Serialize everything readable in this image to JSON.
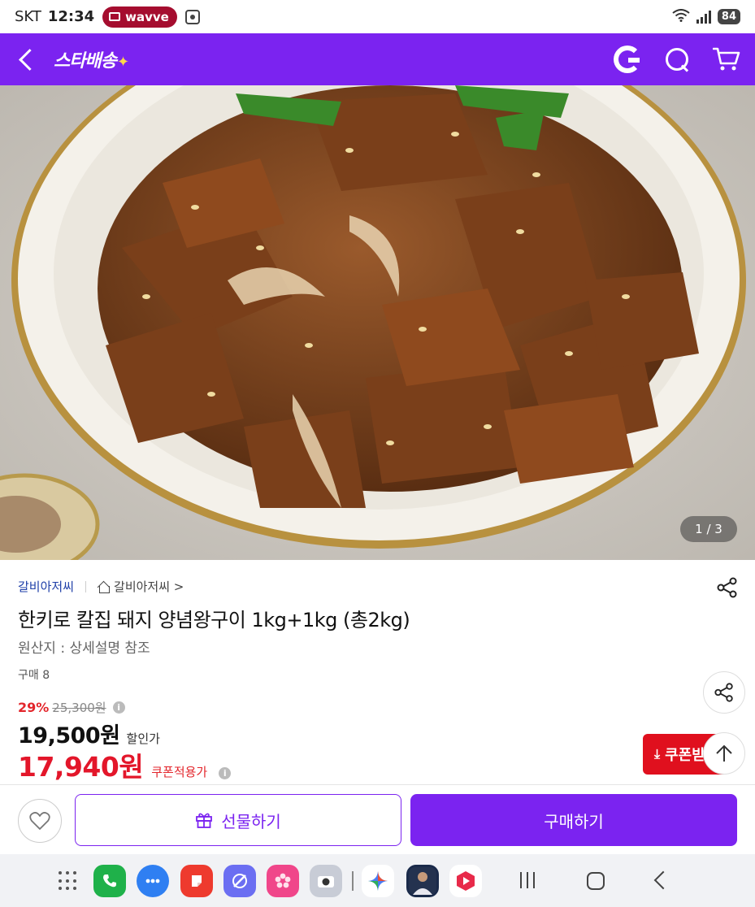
{
  "status_bar": {
    "carrier": "SKT",
    "time": "12:34",
    "app_pill": "wavve",
    "battery": "84"
  },
  "header": {
    "brand": "스타배송",
    "brand_star": "✦"
  },
  "gallery": {
    "counter": "1 / 3"
  },
  "product": {
    "seller": "갈비아저씨",
    "shop_link": "갈비아저씨 >",
    "title": "한키로 칼집 돼지 양념왕구이 1kg+1kg (총2kg)",
    "origin": "원산지 : 상세설명 참조",
    "purchases": "구매 8",
    "discount_rate": "29%",
    "original_price": "25,300원",
    "sale_price": "19,500원",
    "sale_label": "할인가",
    "coupon_price": "17,940원",
    "coupon_label": "쿠폰적용가",
    "info_glyph": "i"
  },
  "floating": {
    "coupon_button": "쿠폰받"
  },
  "actions": {
    "gift": "선물하기",
    "buy": "구매하기"
  },
  "colors": {
    "brand_purple": "#7b23f0",
    "price_red": "#e3162a",
    "seller_blue": "#1f3fa8"
  }
}
